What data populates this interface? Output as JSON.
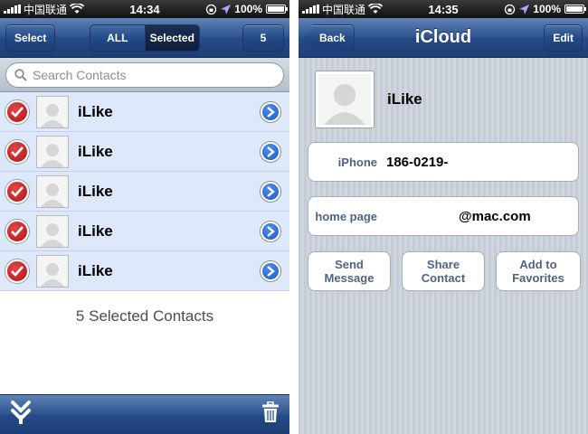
{
  "left": {
    "statusbar": {
      "carrier": "中国联通",
      "time": "14:34",
      "battery": "100%"
    },
    "navbar": {
      "select_label": "Select",
      "seg_all": "ALL",
      "seg_selected": "Selected",
      "count_label": "5"
    },
    "search": {
      "placeholder": "Search Contacts"
    },
    "contacts": [
      {
        "name": "iLike"
      },
      {
        "name": "iLike"
      },
      {
        "name": "iLike"
      },
      {
        "name": "iLike"
      },
      {
        "name": "iLike"
      }
    ],
    "selected_text": "5 Selected Contacts",
    "toolbar": {
      "left_icon": "merge-down-icon",
      "right_icon": "trash-icon"
    }
  },
  "right": {
    "statusbar": {
      "carrier": "中国联通",
      "time": "14:35",
      "battery": "100%"
    },
    "navbar": {
      "back_label": "Back",
      "title": "iCloud",
      "edit_label": "Edit"
    },
    "contact": {
      "name": "iLike",
      "phone_label": "iPhone",
      "phone_value": "186-0219-",
      "homepage_label": "home page",
      "homepage_value": "@mac.com"
    },
    "actions": {
      "send_message": [
        "Send",
        "Message"
      ],
      "share_contact": [
        "Share",
        "Contact"
      ],
      "add_favorites": [
        "Add to",
        "Favorites"
      ]
    }
  },
  "colors": {
    "nav_blue": "#2d538f",
    "row_selected": "#dde8fb",
    "check_red": "#c31c1c",
    "disclosure_blue": "#1b5cc8"
  }
}
